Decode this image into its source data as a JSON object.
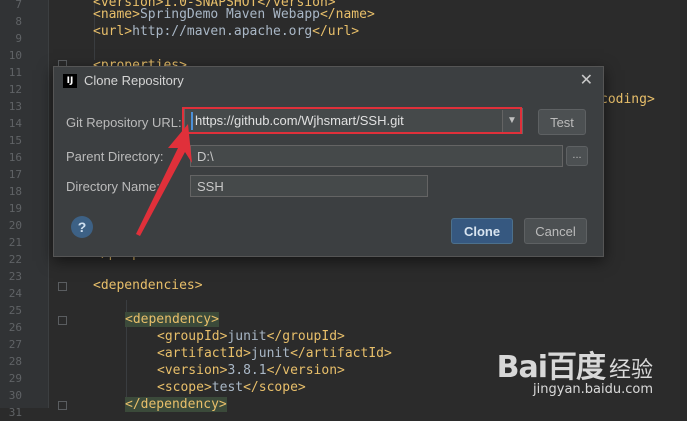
{
  "editor": {
    "line_numbers": [
      "7",
      "8",
      "9",
      "10",
      "11",
      "12",
      "13",
      "14",
      "15",
      "16",
      "17",
      "18",
      "19",
      "20",
      "21",
      "22",
      "23",
      "24",
      "25",
      "26",
      "27",
      "28",
      "29",
      "30",
      "31"
    ],
    "lines": {
      "l7": "<version>1.0-SNAPSHOT</version>",
      "l8_open": "<name>",
      "l8_text": "SpringDemo Maven Webapp",
      "l8_close": "</name>",
      "l9_open": "<url>",
      "l9_text": "http://maven.apache.org",
      "l9_close": "</url>",
      "l11": "<properties>",
      "l12_tail": "coding>",
      "l22": "</properties>",
      "l24": "<dependencies>",
      "l26": "<dependency>",
      "l27_open": "<groupId>",
      "l27_text": "junit",
      "l27_close": "</groupId>",
      "l28_open": "<artifactId>",
      "l28_text": "junit",
      "l28_close": "</artifactId>",
      "l29_open": "<version>",
      "l29_text": "3.8.1",
      "l29_close": "</version>",
      "l30_open": "<scope>",
      "l30_text": "test",
      "l30_close": "</scope>",
      "l31": "</dependency>"
    }
  },
  "dialog": {
    "app_icon": "IJ",
    "title": "Clone Repository",
    "close_glyph": "✕",
    "git_url_label": "Git Repository URL:",
    "git_url_value": "https://github.com/Wjhsmart/SSH.git",
    "dropdown_glyph": "▼",
    "test_button": "Test",
    "parent_dir_label": "Parent Directory:",
    "parent_dir_value": "D:\\",
    "browse_button": "...",
    "dir_name_label": "Directory Name:",
    "dir_name_value": "SSH",
    "help_glyph": "?",
    "clone_button": "Clone",
    "cancel_button": "Cancel"
  },
  "annotation": {
    "highlight_color": "#e0303a",
    "arrow_color": "#e0303a"
  },
  "watermark": {
    "logo": "Bai百度",
    "cn": "经验",
    "url": "jingyan.baidu.com"
  }
}
